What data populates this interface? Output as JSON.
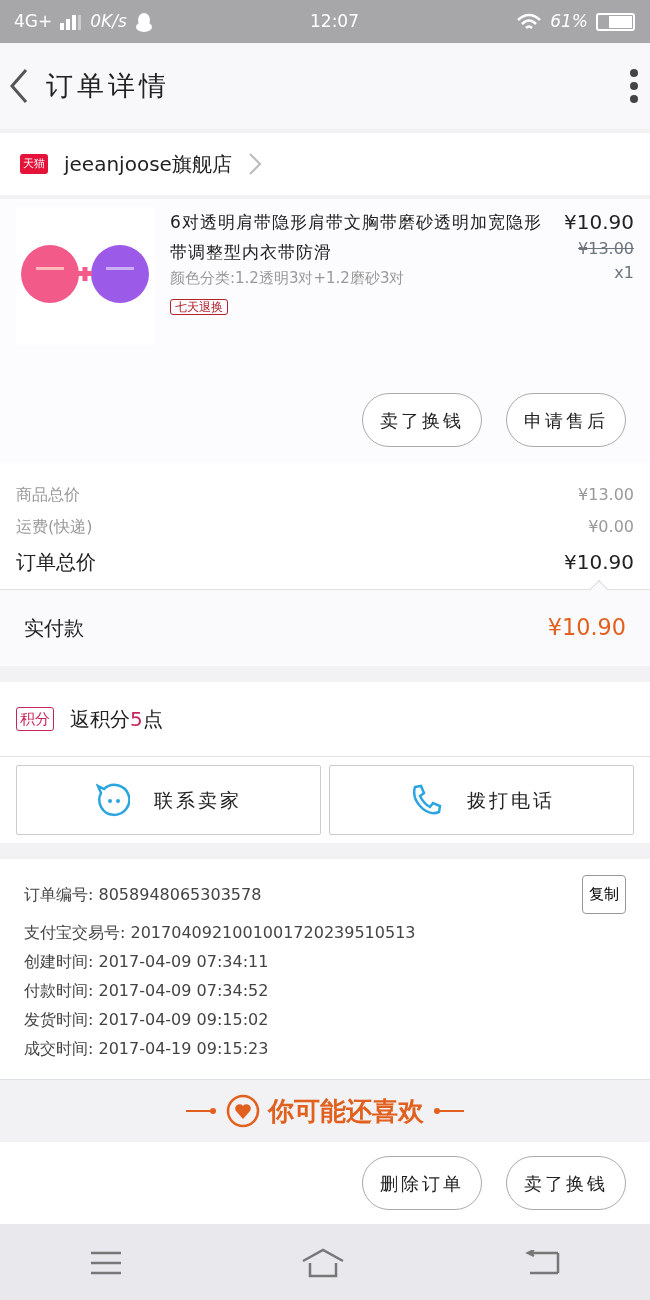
{
  "status_bar": {
    "network": "4G+",
    "speed": "0K/s",
    "time": "12:07",
    "battery_text": "61%"
  },
  "header": {
    "title": "订单详情"
  },
  "shop": {
    "badge": "天猫",
    "name": "jeeanjoose旗舰店"
  },
  "product": {
    "title": "6对透明肩带隐形肩带文胸带磨砂透明加宽隐形带调整型内衣带防滑",
    "spec": "颜色分类:1.2透明3对+1.2磨砂3对",
    "tag": "七天退换",
    "price": "¥10.90",
    "original_price": "¥13.00",
    "quantity": "x1"
  },
  "product_actions": [
    "卖了换钱",
    "申请售后"
  ],
  "summary": [
    {
      "label": "商品总价",
      "value": "¥13.00",
      "kind": "sub"
    },
    {
      "label": "运费(快递)",
      "value": "¥0.00",
      "kind": "sub"
    },
    {
      "label": "订单总价",
      "value": "¥10.90",
      "kind": "total"
    }
  ],
  "paid": {
    "label": "实付款",
    "value": "¥10.90"
  },
  "points": {
    "badge": "积分",
    "prefix": "返积分",
    "amount": "5",
    "suffix": "点"
  },
  "contact": [
    {
      "label": "联系卖家",
      "kind": "chat"
    },
    {
      "label": "拨打电话",
      "kind": "phone"
    }
  ],
  "order_info": {
    "copy_button": "复制",
    "rows": [
      {
        "label": "订单编号:",
        "value": "8058948065303578"
      },
      {
        "label": "支付宝交易号:",
        "value": "2017040921001001720239510513"
      },
      {
        "label": "创建时间:",
        "value": "2017-04-09 07:34:11"
      },
      {
        "label": "付款时间:",
        "value": "2017-04-09 07:34:52"
      },
      {
        "label": "发货时间:",
        "value": "2017-04-09 09:15:02"
      },
      {
        "label": "成交时间:",
        "value": "2017-04-19 09:15:23"
      }
    ]
  },
  "recommend": {
    "title": "你可能还喜欢"
  },
  "bottom_actions": [
    "删除订单",
    "卖了换钱"
  ]
}
